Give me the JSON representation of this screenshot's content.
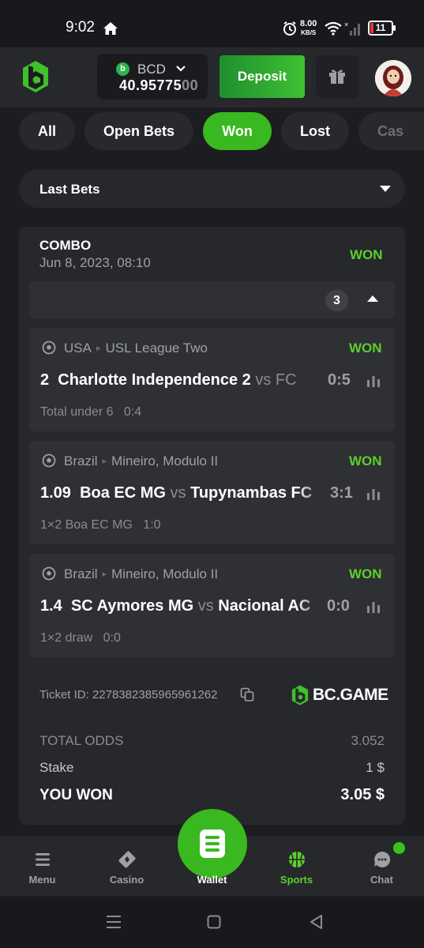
{
  "status_bar": {
    "time": "9:02",
    "net_speed_top": "8.00",
    "net_speed_bottom": "KB/S",
    "battery": "11",
    "icons": [
      "home-icon",
      "alarm-icon",
      "wifi-icon",
      "signal-icon",
      "battery-icon"
    ]
  },
  "header": {
    "currency": "BCD",
    "currency_icon": "b",
    "balance_main": "40.95775",
    "balance_tail": "00",
    "deposit_label": "Deposit",
    "icons": [
      "bc-logo-icon",
      "chevron-down-icon",
      "gift-icon",
      "avatar"
    ]
  },
  "filters": {
    "tabs": [
      "All",
      "Open Bets",
      "Won",
      "Lost",
      "Cas"
    ],
    "active": "Won"
  },
  "dropdown": {
    "label": "Last Bets"
  },
  "bet": {
    "type": "COMBO",
    "date": "Jun 8, 2023, 08:10",
    "status": "WON",
    "legs_count": "3",
    "legs": [
      {
        "country": "USA",
        "league": "USL League Two",
        "status": "WON",
        "odds": "2",
        "home": "Charlotte Independence 2",
        "vs": "vs",
        "away": "FC",
        "score": "0:5",
        "selection": "Total under 6",
        "selection_score": "0:4"
      },
      {
        "country": "Brazil",
        "league": "Mineiro, Modulo II",
        "status": "WON",
        "odds": "1.09",
        "home": "Boa EC MG",
        "vs": "vs",
        "away": "Tupynambas FC",
        "score": "3:1",
        "selection": "1×2 Boa EC MG",
        "selection_score": "1:0"
      },
      {
        "country": "Brazil",
        "league": "Mineiro, Modulo II",
        "status": "WON",
        "odds": "1.4",
        "home": "SC Aymores MG",
        "vs": "vs",
        "away": "Nacional AC",
        "score": "0:0",
        "selection": "1×2 draw",
        "selection_score": "0:0"
      }
    ],
    "ticket_label": "Ticket ID:",
    "ticket_id": "2278382385965961262",
    "brand": "BC.GAME",
    "total_odds_label": "TOTAL ODDS",
    "total_odds": "3.052",
    "stake_label": "Stake",
    "stake": "1 $",
    "you_won_label": "YOU WON",
    "you_won": "3.05 $"
  },
  "bottom_nav": {
    "items": [
      "Menu",
      "Casino",
      "Wallet",
      "Sports",
      "Chat"
    ],
    "active": "Sports"
  },
  "colors": {
    "accent": "#39b81f",
    "won": "#5dcf2a",
    "background": "#1b1d20",
    "card": "#26282c"
  }
}
